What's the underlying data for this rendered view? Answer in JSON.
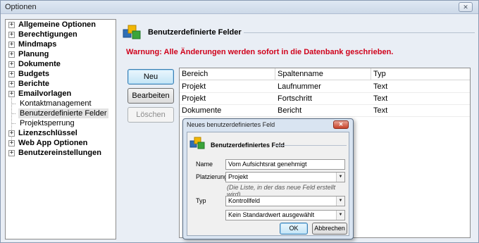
{
  "window": {
    "title": "Optionen",
    "close_glyph": "✕"
  },
  "tree": {
    "expand_glyph": "+",
    "items": [
      {
        "label": "Allgemeine Optionen"
      },
      {
        "label": "Berechtigungen"
      },
      {
        "label": "Mindmaps"
      },
      {
        "label": "Planung"
      },
      {
        "label": "Dokumente"
      },
      {
        "label": "Budgets"
      },
      {
        "label": "Berichte"
      },
      {
        "label": "Emailvorlagen"
      },
      {
        "label": "Lizenzschlüssel"
      },
      {
        "label": "Web App Optionen"
      },
      {
        "label": "Benutzereinstellungen"
      }
    ],
    "children": [
      {
        "label": "Kontaktmanagement"
      },
      {
        "label": "Benutzerdefinierte Felder",
        "selected": true
      },
      {
        "label": "Projektsperrung"
      }
    ]
  },
  "panel": {
    "title": "Benutzerdefinierte Felder",
    "warning": "Warnung: Alle Änderungen werden sofort in die Datenbank geschrieben.",
    "buttons": {
      "new": "Neu",
      "edit": "Bearbeiten",
      "delete": "Löschen"
    }
  },
  "grid": {
    "columns": [
      "Bereich",
      "Spaltenname",
      "Typ"
    ],
    "rows": [
      [
        "Projekt",
        "Laufnummer",
        "Text"
      ],
      [
        "Projekt",
        "Fortschritt",
        "Text"
      ],
      [
        "Dokumente",
        "Bericht",
        "Text"
      ]
    ]
  },
  "dialog": {
    "title": "Neues benutzerdefiniertes Feld",
    "close_glyph": "✕",
    "header": "Benutzerdefiniertes Feld",
    "name_label": "Name",
    "name_value": "Vom Aufsichtsrat genehmigt",
    "placement_label": "Platzierung",
    "placement_value": "Projekt",
    "placement_note": "(Die Liste, in der das neue Feld erstellt wird)",
    "type_label": "Typ",
    "type_value": "Kontrollfeld",
    "default_value": "Kein Standardwert ausgewählt",
    "ok": "OK",
    "cancel": "Abbrechen",
    "dropdown_glyph": "▼"
  },
  "colors": {
    "warning": "#d0021b",
    "accent": "#3c7fb1",
    "dialog_frame": "#d9e4f1"
  }
}
